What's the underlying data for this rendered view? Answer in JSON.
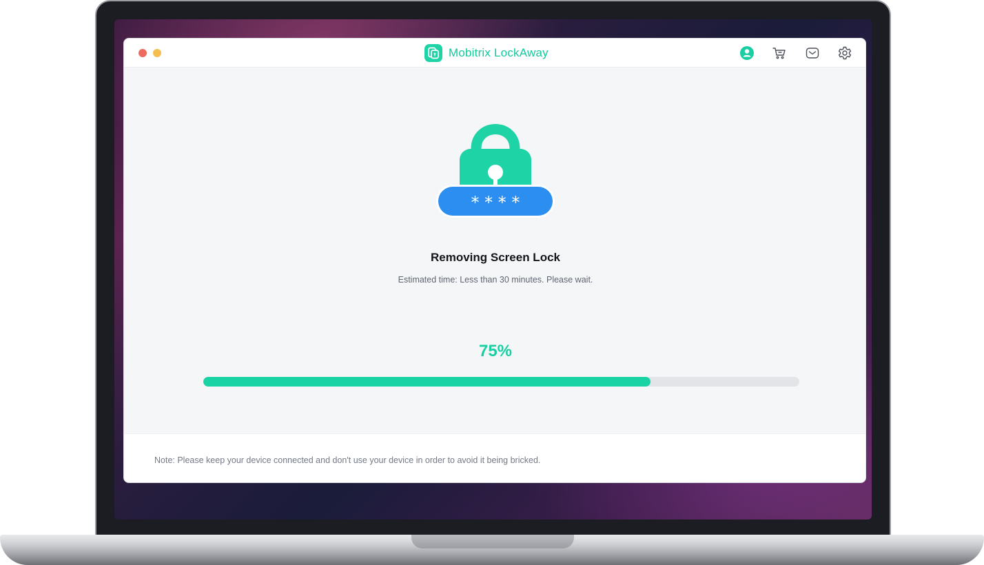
{
  "app": {
    "title": "Mobitrix LockAway",
    "accent_color": "#19d3a4",
    "lock_badge_color": "#2b8ef0"
  },
  "titlebar": {
    "icons": [
      "account-icon",
      "cart-icon",
      "mail-icon",
      "settings-icon"
    ]
  },
  "main": {
    "badge_text": "* * * *",
    "title": "Removing Screen Lock",
    "subtitle": "Estimated time: Less than 30 minutes. Please wait.",
    "progress_label": "75%",
    "progress_value": 0.75
  },
  "footer": {
    "note": "Note: Please keep your device connected and don't use your device in order to avoid it being bricked."
  }
}
